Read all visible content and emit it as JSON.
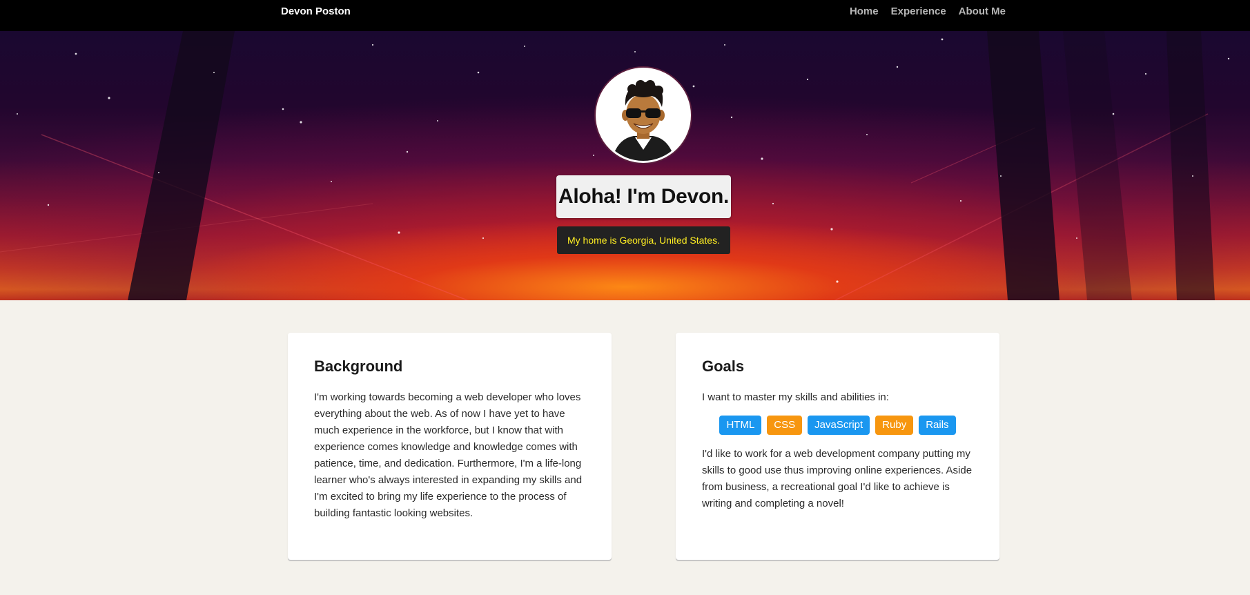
{
  "navbar": {
    "brand": "Devon Poston",
    "links": [
      "Home",
      "Experience",
      "About Me"
    ]
  },
  "hero": {
    "title": "Aloha! I'm Devon.",
    "subtitle": "My home is Georgia, United States."
  },
  "background_card": {
    "heading": "Background",
    "body": "I'm working towards becoming a web developer who loves everything about the web. As of now I have yet to have much experience in the workforce, but I know that with experience comes knowledge and knowledge comes with patience, time, and dedication. Furthermore, I'm a life-long learner who's always interested in expanding my skills and I'm excited to bring my life experience to the process of building fantastic looking websites."
  },
  "goals_card": {
    "heading": "Goals",
    "intro": "I want to master my skills and abilities in:",
    "skills": [
      {
        "label": "HTML",
        "color": "#1a97f0"
      },
      {
        "label": "CSS",
        "color": "#f7960f"
      },
      {
        "label": "JavaScript",
        "color": "#1a97f0"
      },
      {
        "label": "Ruby",
        "color": "#f7960f"
      },
      {
        "label": "Rails",
        "color": "#1a97f0"
      }
    ],
    "body": "I'd like to work for a web development company putting my skills to good use thus improving online experiences. Aside from business, a recreational goal I'd like to achieve is writing and completing a novel!"
  },
  "colors": {
    "navbar_bg": "#000000",
    "page_bg": "#f4f2ec",
    "subtitle_text": "#ffee22",
    "badge_blue": "#1a97f0",
    "badge_orange": "#f7960f"
  }
}
